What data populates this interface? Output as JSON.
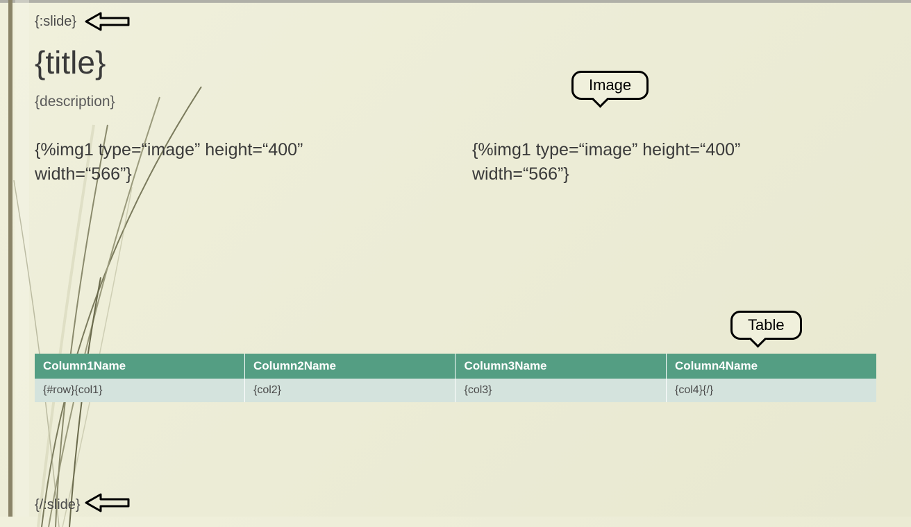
{
  "slide": {
    "open_tag": "{:slide}",
    "close_tag": "{/:slide}",
    "title": "{title}",
    "description": "{description}",
    "img1": "{%img1 type=“image” height=“400” width=“566”}",
    "img2": "{%img1 type=“image” height=“400” width=“566”}"
  },
  "table": {
    "headers": [
      "Column1Name",
      "Column2Name",
      "Column3Name",
      "Column4Name"
    ],
    "rows": [
      {
        "col1": "{#row}{col1}",
        "col2": "{col2}",
        "col3": "{col3}",
        "col4": "{col4}{/}"
      }
    ]
  },
  "annotations": {
    "image_label": "Image",
    "table_label": "Table"
  }
}
